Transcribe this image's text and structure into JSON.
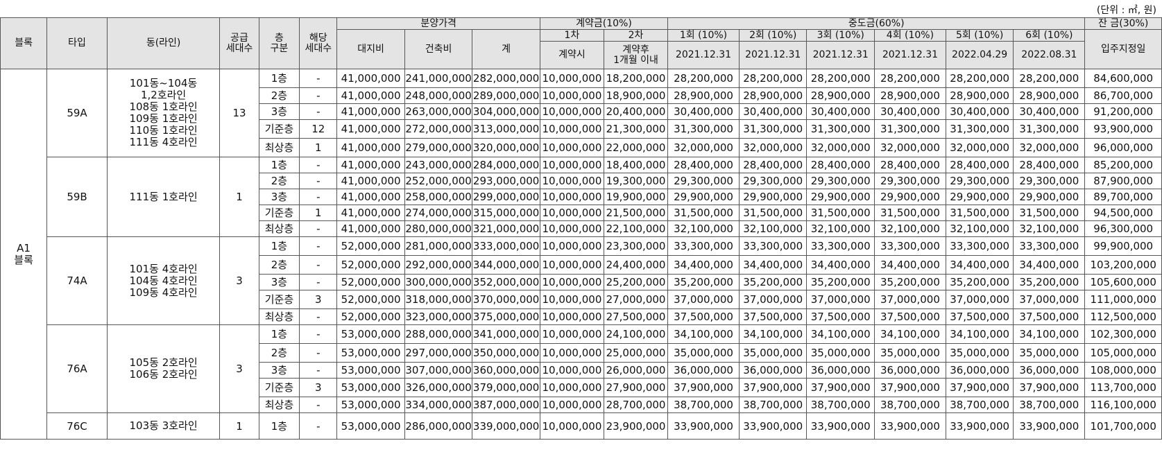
{
  "unit_note": "(단위 : ㎡, 원)",
  "headers": {
    "block": "블록",
    "type": "타입",
    "dong": "동(라인)",
    "supply": "공급\n세대수",
    "floor": "층\n구분",
    "units": "해당\n세대수",
    "sale_price": "분양가격",
    "land": "대지비",
    "building": "건축비",
    "total": "계",
    "deposit": "계약금(10%)",
    "dep1": "1차",
    "dep2": "2차",
    "dep1_when": "계약시",
    "dep2_when": "계약후\n1개월 이내",
    "middle": "중도금(60%)",
    "mid_labels": [
      "1회 (10%)",
      "2회 (10%)",
      "3회 (10%)",
      "4회 (10%)",
      "5회 (10%)",
      "6회 (10%)"
    ],
    "mid_dates": [
      "2021.12.31",
      "2021.12.31",
      "2021.12.31",
      "2021.12.31",
      "2022.04.29",
      "2022.08.31"
    ],
    "balance": "잔 금(30%)",
    "balance_when": "입주지정일"
  },
  "block_name": "A1\n블록",
  "groups": [
    {
      "type": "59A",
      "dong": "101동~104동\n1,2호라인\n108동 1호라인\n109동 1호라인\n110동 1호라인\n111동 4호라인",
      "supply": "13",
      "rows": [
        {
          "floor": "1층",
          "units": "-",
          "land": "41,000,000",
          "build": "241,000,000",
          "total": "282,000,000",
          "d1": "10,000,000",
          "d2": "18,200,000",
          "m": "28,200,000",
          "bal": "84,600,000"
        },
        {
          "floor": "2층",
          "units": "-",
          "land": "41,000,000",
          "build": "248,000,000",
          "total": "289,000,000",
          "d1": "10,000,000",
          "d2": "18,900,000",
          "m": "28,900,000",
          "bal": "86,700,000"
        },
        {
          "floor": "3층",
          "units": "-",
          "land": "41,000,000",
          "build": "263,000,000",
          "total": "304,000,000",
          "d1": "10,000,000",
          "d2": "20,400,000",
          "m": "30,400,000",
          "bal": "91,200,000"
        },
        {
          "floor": "기준층",
          "units": "12",
          "land": "41,000,000",
          "build": "272,000,000",
          "total": "313,000,000",
          "d1": "10,000,000",
          "d2": "21,300,000",
          "m": "31,300,000",
          "bal": "93,900,000"
        },
        {
          "floor": "최상층",
          "units": "1",
          "land": "41,000,000",
          "build": "279,000,000",
          "total": "320,000,000",
          "d1": "10,000,000",
          "d2": "22,000,000",
          "m": "32,000,000",
          "bal": "96,000,000"
        }
      ]
    },
    {
      "type": "59B",
      "dong": "111동 1호라인",
      "supply": "1",
      "rows": [
        {
          "floor": "1층",
          "units": "-",
          "land": "41,000,000",
          "build": "243,000,000",
          "total": "284,000,000",
          "d1": "10,000,000",
          "d2": "18,400,000",
          "m": "28,400,000",
          "bal": "85,200,000"
        },
        {
          "floor": "2층",
          "units": "-",
          "land": "41,000,000",
          "build": "252,000,000",
          "total": "293,000,000",
          "d1": "10,000,000",
          "d2": "19,300,000",
          "m": "29,300,000",
          "bal": "87,900,000"
        },
        {
          "floor": "3층",
          "units": "-",
          "land": "41,000,000",
          "build": "258,000,000",
          "total": "299,000,000",
          "d1": "10,000,000",
          "d2": "19,900,000",
          "m": "29,900,000",
          "bal": "89,700,000"
        },
        {
          "floor": "기준층",
          "units": "1",
          "land": "41,000,000",
          "build": "274,000,000",
          "total": "315,000,000",
          "d1": "10,000,000",
          "d2": "21,500,000",
          "m": "31,500,000",
          "bal": "94,500,000"
        },
        {
          "floor": "최상층",
          "units": "-",
          "land": "41,000,000",
          "build": "280,000,000",
          "total": "321,000,000",
          "d1": "10,000,000",
          "d2": "22,100,000",
          "m": "32,100,000",
          "bal": "96,300,000"
        }
      ]
    },
    {
      "type": "74A",
      "dong": "101동 4호라인\n104동 4호라인\n109동 4호라인",
      "supply": "3",
      "rows": [
        {
          "floor": "1층",
          "units": "-",
          "land": "52,000,000",
          "build": "281,000,000",
          "total": "333,000,000",
          "d1": "10,000,000",
          "d2": "23,300,000",
          "m": "33,300,000",
          "bal": "99,900,000"
        },
        {
          "floor": "2층",
          "units": "-",
          "land": "52,000,000",
          "build": "292,000,000",
          "total": "344,000,000",
          "d1": "10,000,000",
          "d2": "24,400,000",
          "m": "34,400,000",
          "bal": "103,200,000"
        },
        {
          "floor": "3층",
          "units": "-",
          "land": "52,000,000",
          "build": "300,000,000",
          "total": "352,000,000",
          "d1": "10,000,000",
          "d2": "25,200,000",
          "m": "35,200,000",
          "bal": "105,600,000"
        },
        {
          "floor": "기준층",
          "units": "3",
          "land": "52,000,000",
          "build": "318,000,000",
          "total": "370,000,000",
          "d1": "10,000,000",
          "d2": "27,000,000",
          "m": "37,000,000",
          "bal": "111,000,000"
        },
        {
          "floor": "최상층",
          "units": "-",
          "land": "52,000,000",
          "build": "323,000,000",
          "total": "375,000,000",
          "d1": "10,000,000",
          "d2": "27,500,000",
          "m": "37,500,000",
          "bal": "112,500,000"
        }
      ]
    },
    {
      "type": "76A",
      "dong": "105동 2호라인\n106동 2호라인",
      "supply": "3",
      "rows": [
        {
          "floor": "1층",
          "units": "-",
          "land": "53,000,000",
          "build": "288,000,000",
          "total": "341,000,000",
          "d1": "10,000,000",
          "d2": "24,100,000",
          "m": "34,100,000",
          "bal": "102,300,000"
        },
        {
          "floor": "2층",
          "units": "-",
          "land": "53,000,000",
          "build": "297,000,000",
          "total": "350,000,000",
          "d1": "10,000,000",
          "d2": "25,000,000",
          "m": "35,000,000",
          "bal": "105,000,000"
        },
        {
          "floor": "3층",
          "units": "-",
          "land": "53,000,000",
          "build": "307,000,000",
          "total": "360,000,000",
          "d1": "10,000,000",
          "d2": "26,000,000",
          "m": "36,000,000",
          "bal": "108,000,000"
        },
        {
          "floor": "기준층",
          "units": "3",
          "land": "53,000,000",
          "build": "326,000,000",
          "total": "379,000,000",
          "d1": "10,000,000",
          "d2": "27,900,000",
          "m": "37,900,000",
          "bal": "113,700,000"
        },
        {
          "floor": "최상층",
          "units": "-",
          "land": "53,000,000",
          "build": "334,000,000",
          "total": "387,000,000",
          "d1": "10,000,000",
          "d2": "28,700,000",
          "m": "38,700,000",
          "bal": "116,100,000"
        }
      ]
    },
    {
      "type": "76C",
      "dong": "103동 3호라인",
      "supply": "1",
      "rows": [
        {
          "floor": "1층",
          "units": "-",
          "land": "53,000,000",
          "build": "286,000,000",
          "total": "339,000,000",
          "d1": "10,000,000",
          "d2": "23,900,000",
          "m": "33,900,000",
          "bal": "101,700,000"
        }
      ]
    }
  ]
}
